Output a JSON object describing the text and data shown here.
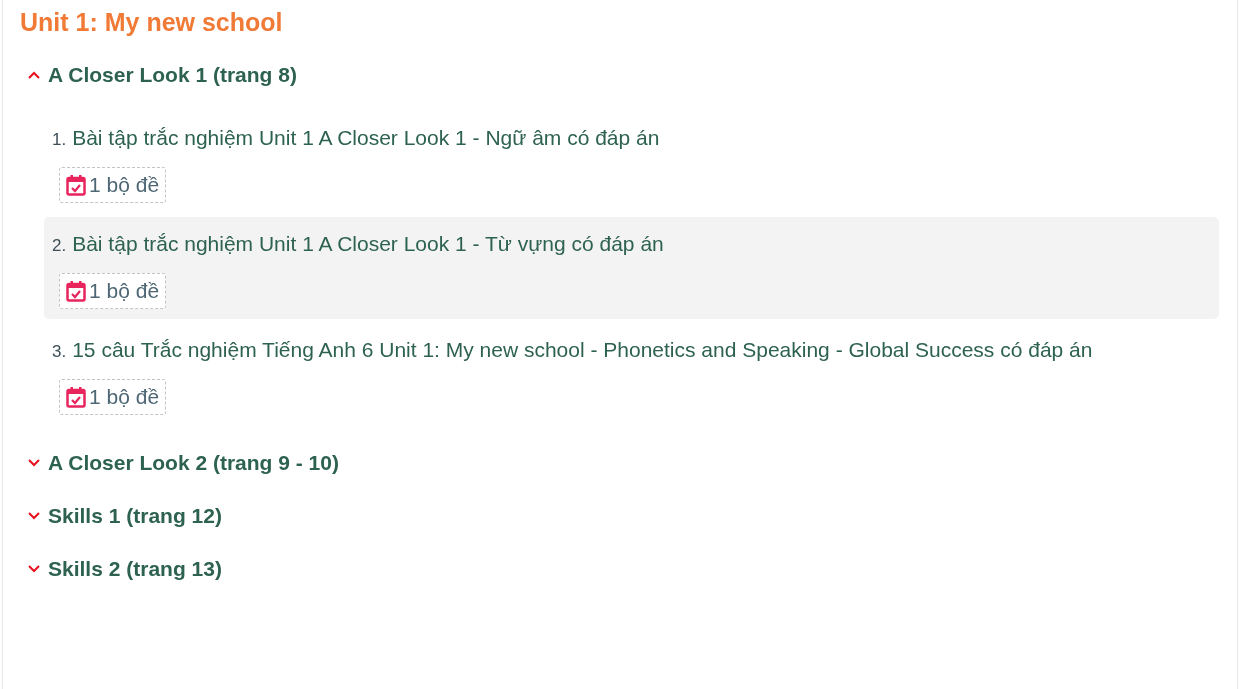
{
  "unit_title": "Unit 1: My new school",
  "sections": [
    {
      "title": "A Closer Look 1 (trang 8)",
      "expanded": true,
      "items": [
        {
          "number": "1.",
          "title": "Bài tập trắc nghiệm Unit 1 A Closer Look 1 - Ngữ âm có đáp án",
          "badge": "1 bộ đề",
          "selected": false
        },
        {
          "number": "2.",
          "title": "Bài tập trắc nghiệm Unit 1 A Closer Look 1 - Từ vựng có đáp án",
          "badge": "1 bộ đề",
          "selected": true
        },
        {
          "number": "3.",
          "title": "15 câu Trắc nghiệm Tiếng Anh 6 Unit 1: My new school - Phonetics and Speaking - Global Success có đáp án",
          "badge": "1 bộ đề",
          "selected": false
        }
      ]
    },
    {
      "title": "A Closer Look 2 (trang 9 - 10)",
      "expanded": false
    },
    {
      "title": "Skills 1 (trang 12)",
      "expanded": false
    },
    {
      "title": "Skills 2 (trang 13)",
      "expanded": false
    }
  ]
}
